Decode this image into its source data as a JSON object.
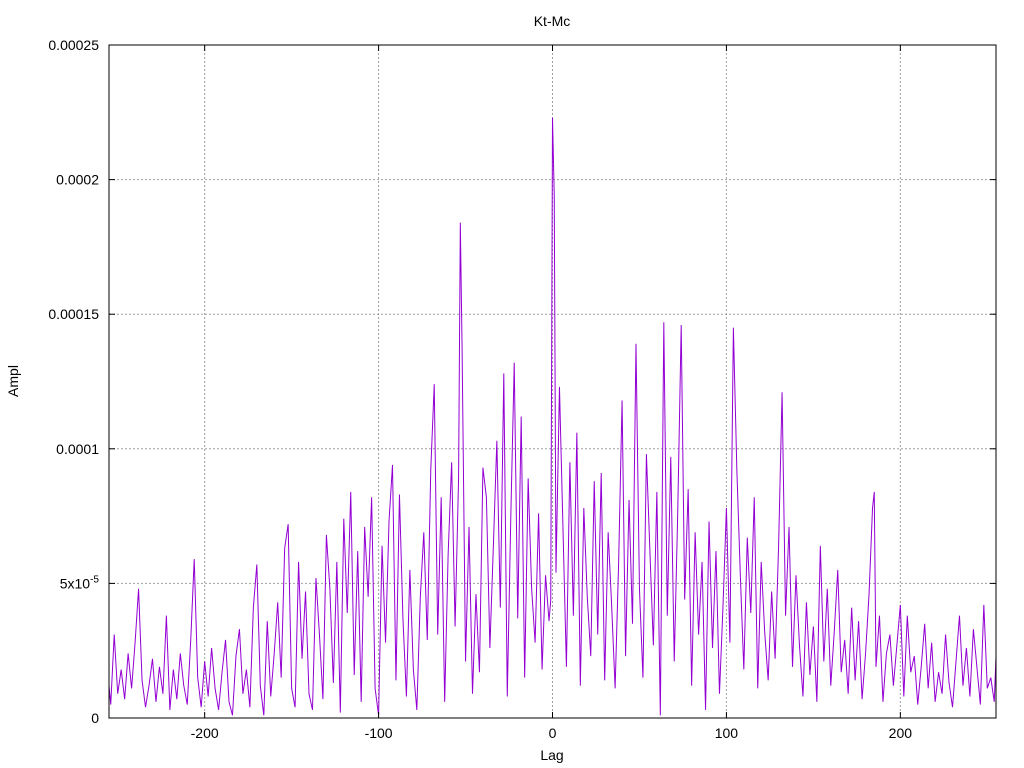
{
  "chart_data": {
    "type": "line",
    "title": "Kt-Mc",
    "xlabel": "Lag",
    "ylabel": "Ampl",
    "xlim": [
      -255,
      255
    ],
    "ylim": [
      0,
      0.00025
    ],
    "grid": true,
    "color": "#9400d3",
    "x_ticks": [
      {
        "value": -200,
        "label": "-200"
      },
      {
        "value": -100,
        "label": "-100"
      },
      {
        "value": 0,
        "label": "0"
      },
      {
        "value": 100,
        "label": "100"
      },
      {
        "value": 200,
        "label": "200"
      }
    ],
    "y_ticks": [
      {
        "value": 0,
        "label": "0"
      },
      {
        "value": 5e-05,
        "label": "5x10",
        "sup": "-5"
      },
      {
        "value": 0.0001,
        "label": "0.0001"
      },
      {
        "value": 0.00015,
        "label": "0.00015"
      },
      {
        "value": 0.0002,
        "label": "0.0002"
      },
      {
        "value": 0.00025,
        "label": "0.00025"
      }
    ],
    "series": [
      {
        "points": [
          [
            -255,
            1.2e-05
          ],
          [
            -254,
            5e-06
          ],
          [
            -252,
            3.1e-05
          ],
          [
            -250,
            9e-06
          ],
          [
            -248,
            1.8e-05
          ],
          [
            -246,
            7e-06
          ],
          [
            -244,
            2.4e-05
          ],
          [
            -242,
            1.1e-05
          ],
          [
            -240,
            2.8e-05
          ],
          [
            -238,
            4.8e-05
          ],
          [
            -236,
            1.4e-05
          ],
          [
            -234,
            4e-06
          ],
          [
            -232,
            1.2e-05
          ],
          [
            -230,
            2.2e-05
          ],
          [
            -228,
            6e-06
          ],
          [
            -226,
            1.9e-05
          ],
          [
            -224,
            9e-06
          ],
          [
            -222,
            3.8e-05
          ],
          [
            -220,
            3e-06
          ],
          [
            -218,
            1.8e-05
          ],
          [
            -216,
            7e-06
          ],
          [
            -214,
            2.4e-05
          ],
          [
            -212,
            1.2e-05
          ],
          [
            -210,
            5e-06
          ],
          [
            -208,
            2.9e-05
          ],
          [
            -206,
            5.9e-05
          ],
          [
            -204,
            1.5e-05
          ],
          [
            -202,
            4e-06
          ],
          [
            -200,
            2.1e-05
          ],
          [
            -198,
            8e-06
          ],
          [
            -196,
            2.6e-05
          ],
          [
            -194,
            1.1e-05
          ],
          [
            -192,
            3e-06
          ],
          [
            -190,
            1.7e-05
          ],
          [
            -188,
            2.9e-05
          ],
          [
            -186,
            6e-06
          ],
          [
            -184,
            1e-06
          ],
          [
            -182,
            2.3e-05
          ],
          [
            -180,
            3.3e-05
          ],
          [
            -178,
            9e-06
          ],
          [
            -176,
            1.8e-05
          ],
          [
            -174,
            4e-06
          ],
          [
            -172,
            4.1e-05
          ],
          [
            -170,
            5.7e-05
          ],
          [
            -168,
            1.2e-05
          ],
          [
            -166,
            1e-06
          ],
          [
            -164,
            3.6e-05
          ],
          [
            -162,
            8e-06
          ],
          [
            -160,
            2.4e-05
          ],
          [
            -158,
            4.3e-05
          ],
          [
            -156,
            1.5e-05
          ],
          [
            -154,
            6.3e-05
          ],
          [
            -152,
            7.2e-05
          ],
          [
            -150,
            1.1e-05
          ],
          [
            -148,
            4e-06
          ],
          [
            -146,
            5.8e-05
          ],
          [
            -144,
            2.2e-05
          ],
          [
            -142,
            4.7e-05
          ],
          [
            -140,
            9e-06
          ],
          [
            -138,
            3e-06
          ],
          [
            -136,
            5.2e-05
          ],
          [
            -134,
            3.1e-05
          ],
          [
            -132,
            7e-06
          ],
          [
            -130,
            6.8e-05
          ],
          [
            -128,
            4.8e-05
          ],
          [
            -126,
            1.3e-05
          ],
          [
            -124,
            5.8e-05
          ],
          [
            -122,
            2e-06
          ],
          [
            -120,
            7.4e-05
          ],
          [
            -118,
            3.9e-05
          ],
          [
            -116,
            8.4e-05
          ],
          [
            -114,
            1.6e-05
          ],
          [
            -112,
            6.2e-05
          ],
          [
            -110,
            6e-06
          ],
          [
            -108,
            7.1e-05
          ],
          [
            -106,
            4.5e-05
          ],
          [
            -104,
            8.2e-05
          ],
          [
            -102,
            1.1e-05
          ],
          [
            -100,
            1e-06
          ],
          [
            -98,
            6.4e-05
          ],
          [
            -96,
            2.8e-05
          ],
          [
            -94,
            7.3e-05
          ],
          [
            -92,
            9.4e-05
          ],
          [
            -90,
            1.4e-05
          ],
          [
            -88,
            8.3e-05
          ],
          [
            -86,
            3.7e-05
          ],
          [
            -84,
            8e-06
          ],
          [
            -82,
            5.5e-05
          ],
          [
            -80,
            1.8e-05
          ],
          [
            -78,
            3e-06
          ],
          [
            -76,
            4.5e-05
          ],
          [
            -74,
            6.9e-05
          ],
          [
            -72,
            2.9e-05
          ],
          [
            -70,
            9.2e-05
          ],
          [
            -68,
            0.000124
          ],
          [
            -66,
            3.1e-05
          ],
          [
            -64,
            8.2e-05
          ],
          [
            -62,
            6e-06
          ],
          [
            -60,
            6.1e-05
          ],
          [
            -58,
            9.5e-05
          ],
          [
            -56,
            3.4e-05
          ],
          [
            -54,
            8.9e-05
          ],
          [
            -53,
            0.000184
          ],
          [
            -52,
            0.000138
          ],
          [
            -50,
            2.1e-05
          ],
          [
            -48,
            7.1e-05
          ],
          [
            -46,
            9e-06
          ],
          [
            -44,
            4.6e-05
          ],
          [
            -42,
            1.7e-05
          ],
          [
            -40,
            9.3e-05
          ],
          [
            -38,
            8.2e-05
          ],
          [
            -36,
            2.6e-05
          ],
          [
            -34,
            6.4e-05
          ],
          [
            -32,
            0.000103
          ],
          [
            -30,
            4.1e-05
          ],
          [
            -28,
            0.000128
          ],
          [
            -26,
            8e-06
          ],
          [
            -24,
            7.4e-05
          ],
          [
            -22,
            0.000132
          ],
          [
            -20,
            3.7e-05
          ],
          [
            -18,
            0.000112
          ],
          [
            -16,
            1.5e-05
          ],
          [
            -14,
            8.9e-05
          ],
          [
            -12,
            4.8e-05
          ],
          [
            -10,
            2.8e-05
          ],
          [
            -8,
            7.6e-05
          ],
          [
            -6,
            1.8e-05
          ],
          [
            -4,
            5.3e-05
          ],
          [
            -2,
            3.6e-05
          ],
          [
            -1,
            4.4e-05
          ],
          [
            0,
            0.000223
          ],
          [
            1,
            0.000194
          ],
          [
            2,
            5.4e-05
          ],
          [
            4,
            0.000123
          ],
          [
            6,
            7.1e-05
          ],
          [
            8,
            1.9e-05
          ],
          [
            10,
            9.5e-05
          ],
          [
            12,
            3.8e-05
          ],
          [
            14,
            0.000106
          ],
          [
            16,
            1.2e-05
          ],
          [
            18,
            7.8e-05
          ],
          [
            20,
            4.5e-05
          ],
          [
            22,
            2.3e-05
          ],
          [
            24,
            8.8e-05
          ],
          [
            26,
            3.1e-05
          ],
          [
            28,
            9.1e-05
          ],
          [
            30,
            1.4e-05
          ],
          [
            32,
            6.9e-05
          ],
          [
            34,
            4.2e-05
          ],
          [
            36,
            1.1e-05
          ],
          [
            38,
            5.7e-05
          ],
          [
            40,
            0.000118
          ],
          [
            42,
            2.3e-05
          ],
          [
            44,
            8.1e-05
          ],
          [
            46,
            3.5e-05
          ],
          [
            48,
            0.000139
          ],
          [
            50,
            4.8e-05
          ],
          [
            52,
            1.5e-05
          ],
          [
            54,
            9.8e-05
          ],
          [
            56,
            6.2e-05
          ],
          [
            58,
            2.7e-05
          ],
          [
            60,
            8.4e-05
          ],
          [
            62,
            1e-06
          ],
          [
            64,
            0.000147
          ],
          [
            66,
            3.8e-05
          ],
          [
            68,
            9.7e-05
          ],
          [
            70,
            2.1e-05
          ],
          [
            72,
            7.6e-05
          ],
          [
            74,
            0.000146
          ],
          [
            76,
            4.4e-05
          ],
          [
            78,
            8.5e-05
          ],
          [
            80,
            1.2e-05
          ],
          [
            82,
            6.9e-05
          ],
          [
            84,
            3.1e-05
          ],
          [
            86,
            5.8e-05
          ],
          [
            88,
            3e-06
          ],
          [
            90,
            7.3e-05
          ],
          [
            92,
            2.6e-05
          ],
          [
            94,
            6.2e-05
          ],
          [
            96,
            9e-06
          ],
          [
            98,
            4.1e-05
          ],
          [
            100,
            7.8e-05
          ],
          [
            102,
            2.8e-05
          ],
          [
            104,
            0.000145
          ],
          [
            106,
            9.2e-05
          ],
          [
            108,
            5.3e-05
          ],
          [
            110,
            1.8e-05
          ],
          [
            112,
            6.7e-05
          ],
          [
            114,
            3.9e-05
          ],
          [
            116,
            8.2e-05
          ],
          [
            118,
            1.1e-05
          ],
          [
            120,
            5.8e-05
          ],
          [
            122,
            3.2e-05
          ],
          [
            124,
            1.4e-05
          ],
          [
            126,
            4.7e-05
          ],
          [
            128,
            2.2e-05
          ],
          [
            130,
            6.4e-05
          ],
          [
            132,
            0.000121
          ],
          [
            134,
            3.8e-05
          ],
          [
            136,
            7.1e-05
          ],
          [
            138,
            1.9e-05
          ],
          [
            140,
            5.3e-05
          ],
          [
            142,
            2.7e-05
          ],
          [
            144,
            8e-06
          ],
          [
            146,
            4.3e-05
          ],
          [
            148,
            1.6e-05
          ],
          [
            150,
            3.4e-05
          ],
          [
            152,
            6e-06
          ],
          [
            154,
            6.4e-05
          ],
          [
            156,
            2.1e-05
          ],
          [
            158,
            4.8e-05
          ],
          [
            160,
            1.2e-05
          ],
          [
            162,
            3.2e-05
          ],
          [
            164,
            5.5e-05
          ],
          [
            166,
            1.7e-05
          ],
          [
            168,
            2.9e-05
          ],
          [
            170,
            9e-06
          ],
          [
            172,
            4.1e-05
          ],
          [
            174,
            1.4e-05
          ],
          [
            176,
            3.6e-05
          ],
          [
            178,
            7e-06
          ],
          [
            180,
            2.4e-05
          ],
          [
            182,
            4.6e-05
          ],
          [
            184,
            7.8e-05
          ],
          [
            185,
            8.4e-05
          ],
          [
            186,
            1.9e-05
          ],
          [
            188,
            3.8e-05
          ],
          [
            190,
            6e-06
          ],
          [
            192,
            2.4e-05
          ],
          [
            194,
            3.1e-05
          ],
          [
            196,
            1.2e-05
          ],
          [
            198,
            2.7e-05
          ],
          [
            200,
            4.2e-05
          ],
          [
            202,
            8e-06
          ],
          [
            204,
            3.8e-05
          ],
          [
            206,
            1.7e-05
          ],
          [
            208,
            2.3e-05
          ],
          [
            210,
            5e-06
          ],
          [
            212,
            1.9e-05
          ],
          [
            214,
            3.5e-05
          ],
          [
            216,
            1.1e-05
          ],
          [
            218,
            2.8e-05
          ],
          [
            220,
            6e-06
          ],
          [
            222,
            1.7e-05
          ],
          [
            224,
            9e-06
          ],
          [
            226,
            3.1e-05
          ],
          [
            228,
            1.3e-05
          ],
          [
            230,
            4e-06
          ],
          [
            232,
            2.1e-05
          ],
          [
            234,
            3.8e-05
          ],
          [
            236,
            1.2e-05
          ],
          [
            238,
            2.6e-05
          ],
          [
            240,
            8e-06
          ],
          [
            242,
            3.3e-05
          ],
          [
            244,
            1.9e-05
          ],
          [
            246,
            5e-06
          ],
          [
            248,
            4.2e-05
          ],
          [
            250,
            1.1e-05
          ],
          [
            252,
            1.5e-05
          ],
          [
            254,
            6e-06
          ],
          [
            255,
            2.3e-05
          ]
        ]
      }
    ]
  }
}
